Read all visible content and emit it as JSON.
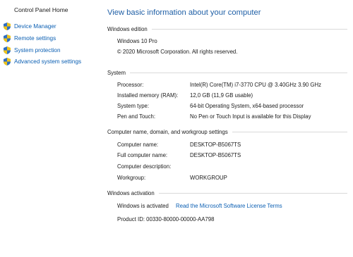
{
  "nav": {
    "home": "Control Panel Home",
    "items": [
      {
        "label": "Device Manager",
        "icon": "shield-icon"
      },
      {
        "label": "Remote settings",
        "icon": "shield-icon"
      },
      {
        "label": "System protection",
        "icon": "shield-icon"
      },
      {
        "label": "Advanced system settings",
        "icon": "shield-icon"
      }
    ]
  },
  "main": {
    "title": "View basic information about your computer",
    "edition": {
      "heading": "Windows edition",
      "name": "Windows 10 Pro",
      "copyright": "© 2020 Microsoft Corporation. All rights reserved."
    },
    "system": {
      "heading": "System",
      "rows": [
        {
          "label": "Processor:",
          "value": "Intel(R) Core(TM) i7-3770 CPU @ 3.40GHz   3.90 GHz"
        },
        {
          "label": "Installed memory (RAM):",
          "value": "12,0 GB (11,9 GB usable)"
        },
        {
          "label": "System type:",
          "value": "64-bit Operating System, x64-based processor"
        },
        {
          "label": "Pen and Touch:",
          "value": "No Pen or Touch Input is available for this Display"
        }
      ]
    },
    "computer": {
      "heading": "Computer name, domain, and workgroup settings",
      "rows": [
        {
          "label": "Computer name:",
          "value": "DESKTOP-B5067TS"
        },
        {
          "label": "Full computer name:",
          "value": "DESKTOP-B5067TS"
        },
        {
          "label": "Computer description:",
          "value": ""
        },
        {
          "label": "Workgroup:",
          "value": "WORKGROUP"
        }
      ]
    },
    "activation": {
      "heading": "Windows activation",
      "status": "Windows is activated",
      "license_link": "Read the Microsoft Software License Terms",
      "product_id": "Product ID: 00330-80000-00000-AA798"
    }
  },
  "colors": {
    "link": "#0b5fb3",
    "title": "#1f5fa6"
  }
}
